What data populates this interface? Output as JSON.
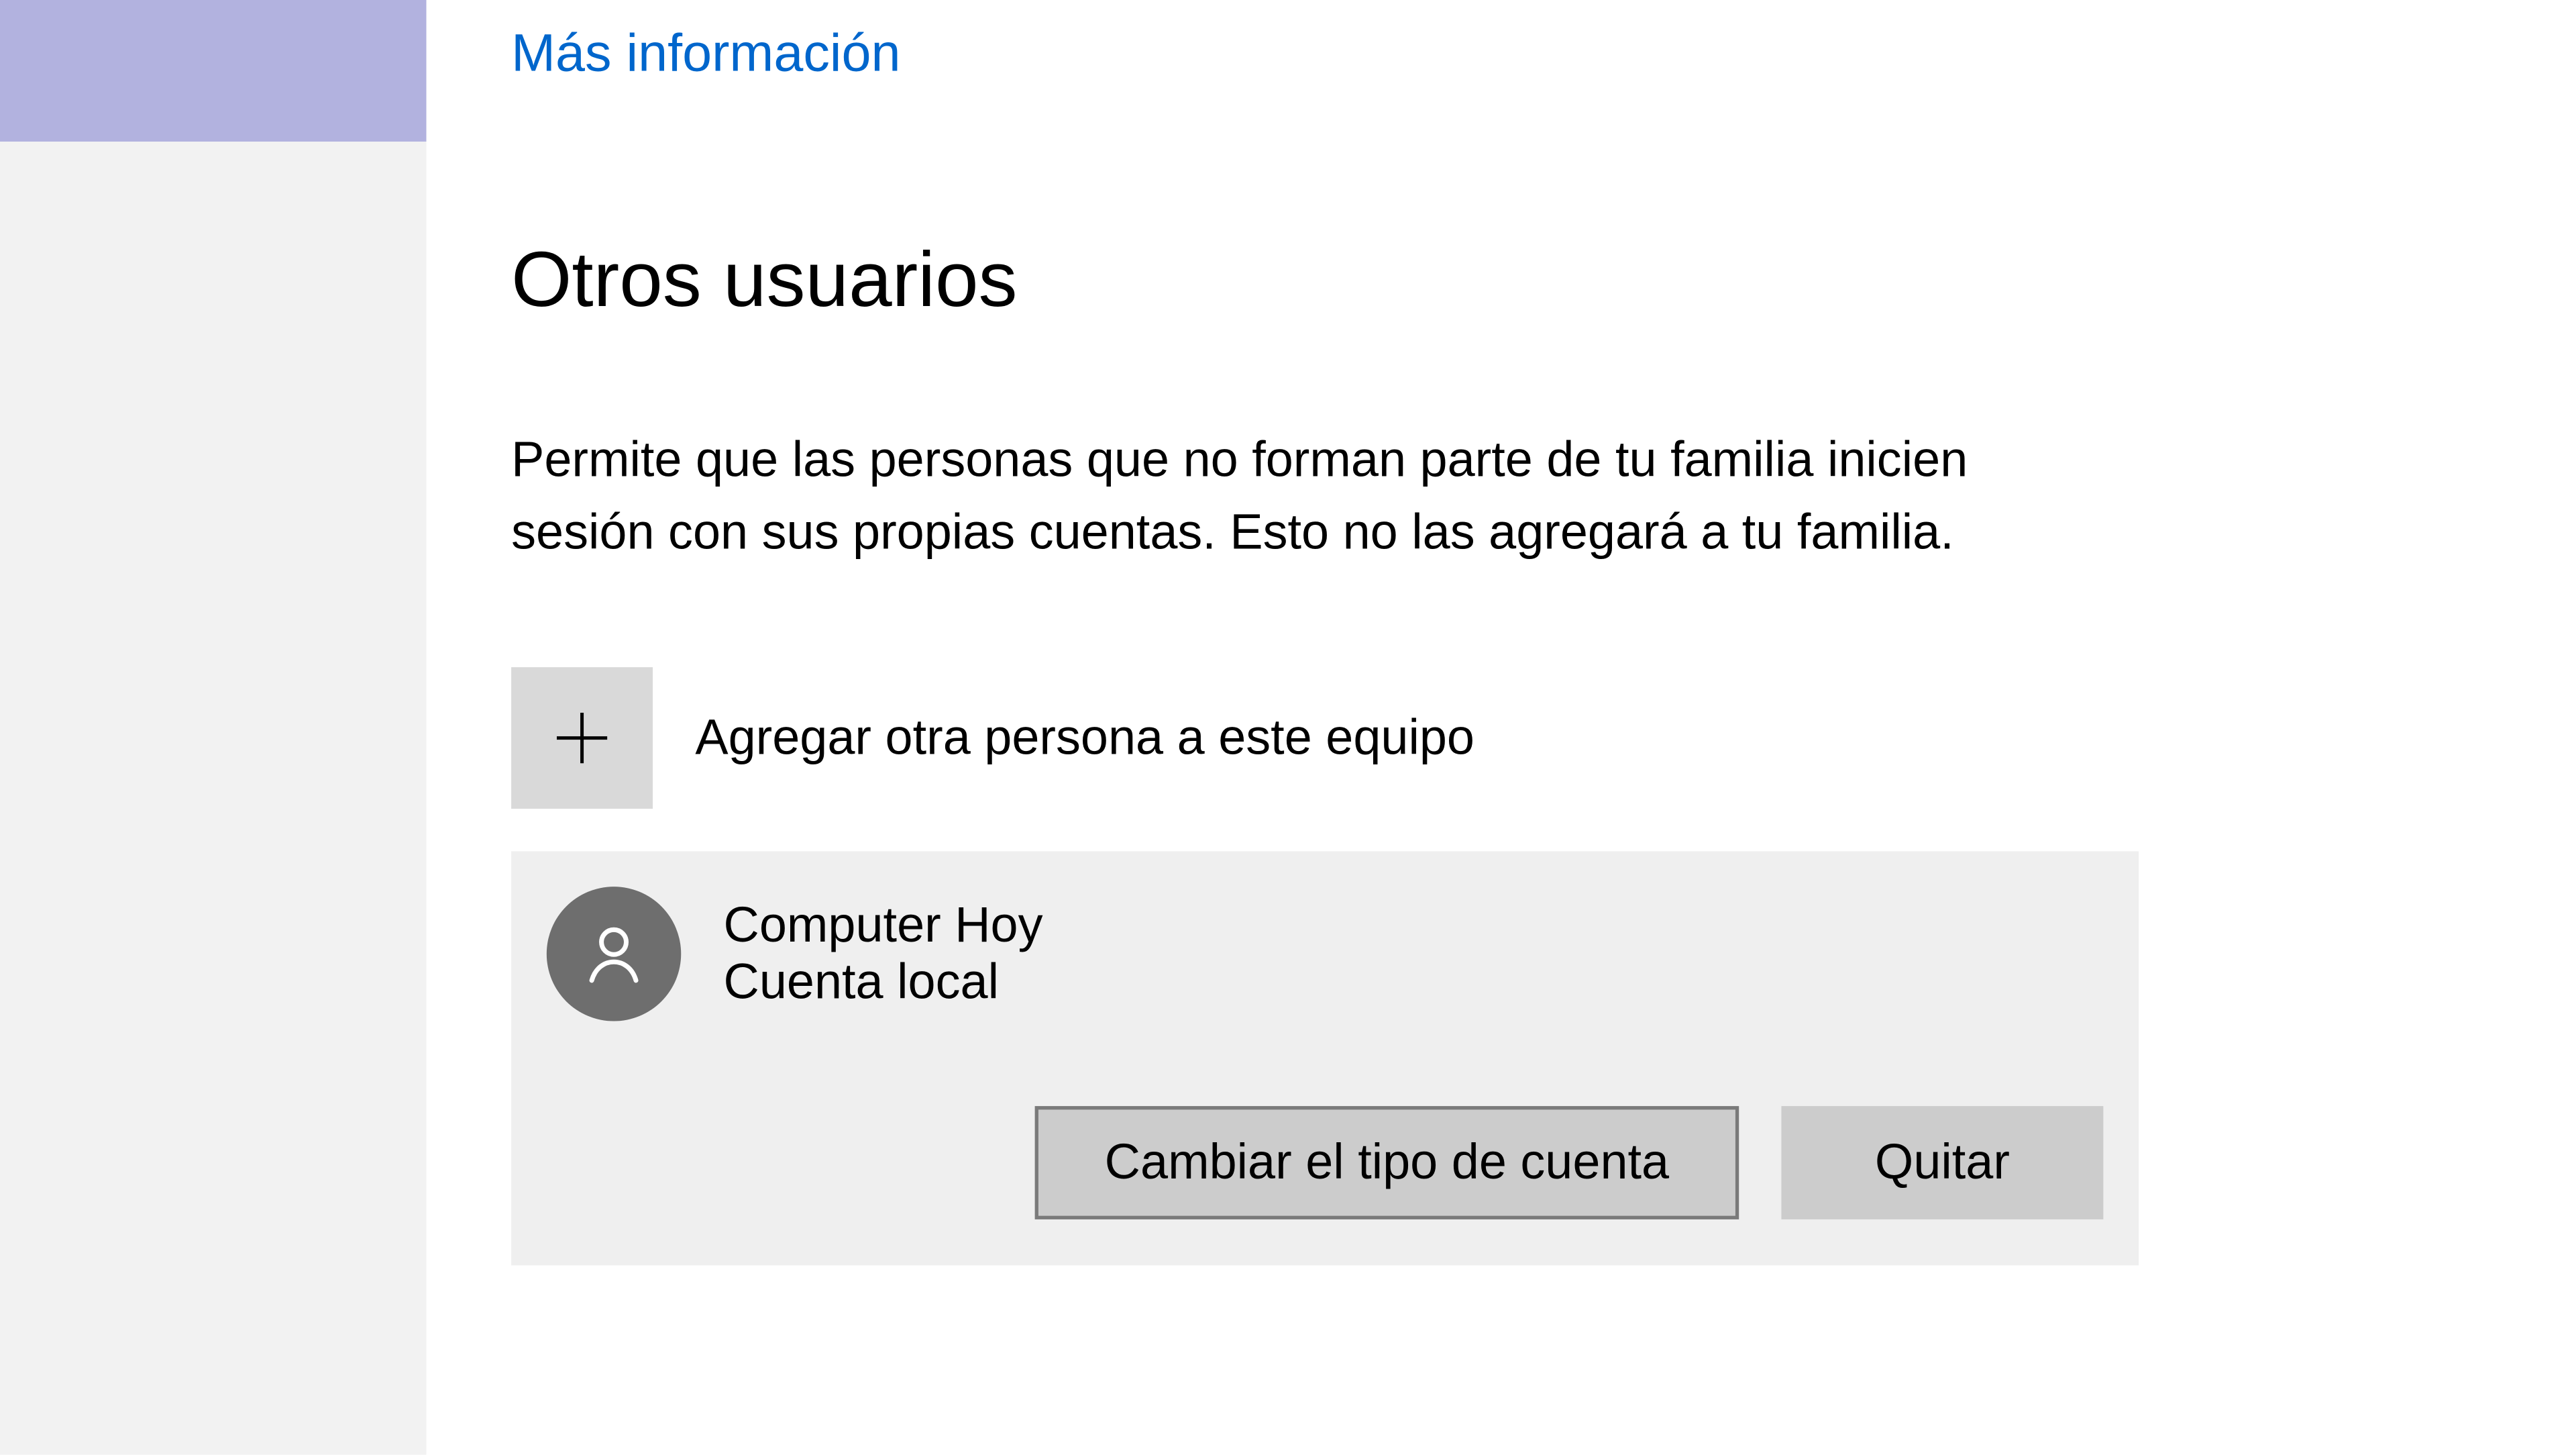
{
  "moreInfo": {
    "label": "Más información"
  },
  "otherUsers": {
    "heading": "Otros usuarios",
    "description": "Permite que las personas que no forman parte de tu familia inicien sesión con sus propias cuentas. Esto no las agregará a tu familia.",
    "addPersonLabel": "Agregar otra persona a este equipo",
    "users": [
      {
        "name": "Computer Hoy",
        "type": "Cuenta local"
      }
    ],
    "buttons": {
      "changeType": "Cambiar el tipo de cuenta",
      "remove": "Quitar"
    }
  },
  "colors": {
    "sidebarHighlight": "#b2b2df",
    "link": "#0066cc",
    "tile": "#d9d9d9",
    "panel": "#efefef",
    "avatar": "#6e6e6e",
    "button": "#cccccc"
  }
}
